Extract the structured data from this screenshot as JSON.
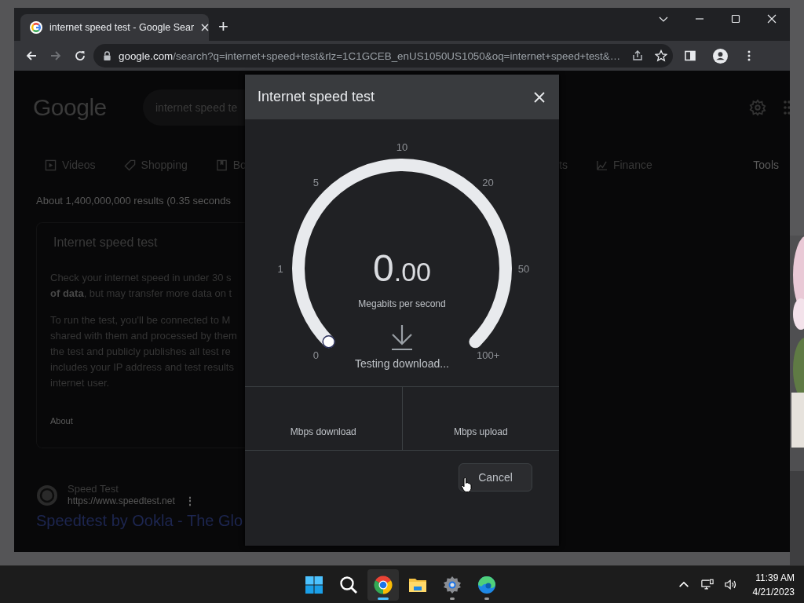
{
  "browser": {
    "tab": {
      "title": "internet speed test - Google Sear"
    },
    "new_tab": "+",
    "forward_disabled": true,
    "omnibox": {
      "host": "google.com",
      "path": "/search?q=internet+speed+test&rlz=1C1GCEB_enUS1050US1050&oq=internet+speed+test&…"
    }
  },
  "page": {
    "logo": "Google",
    "search": {
      "value": "internet speed te"
    },
    "nav_left": [
      {
        "label": "Videos",
        "kind": "video"
      },
      {
        "label": "Shopping",
        "kind": "tag"
      },
      {
        "label": "Bo",
        "kind": "book"
      }
    ],
    "nav_right": [
      {
        "label": "ts",
        "kind": "none"
      },
      {
        "label": "Finance",
        "kind": "chart"
      }
    ],
    "tools": "Tools",
    "stats": "About 1,400,000,000 results (0.35 seconds",
    "card": {
      "title": "Internet speed test",
      "paragraphs": [
        [
          "Check your internet speed in under 30 s",
          "**of data**, but may transfer more data on t"
        ],
        [
          "To run the test, you'll be connected to M",
          "shared with them and processed by them",
          "the test and publicly publishes all test re",
          "includes your IP address and test results",
          "internet user."
        ]
      ],
      "about": "About"
    },
    "result": {
      "site": "Speed Test",
      "url": "https://www.speedtest.net",
      "menu": "⋮",
      "link": "Speedtest by Ookla - The Glo"
    }
  },
  "dialog": {
    "title": "Internet speed test",
    "gauge": {
      "ticks": [
        "0",
        "1",
        "5",
        "10",
        "20",
        "50",
        "100+"
      ],
      "value_whole": "0",
      "value_fraction": ".00",
      "unit": "Megabits per second",
      "status": "Testing download..."
    },
    "results": [
      {
        "label": "Mbps download"
      },
      {
        "label": "Mbps upload"
      }
    ],
    "cancel": "Cancel"
  },
  "taskbar": {
    "apps": [
      {
        "kind": "start",
        "open": false,
        "selected": false
      },
      {
        "kind": "search",
        "open": false,
        "selected": false
      },
      {
        "kind": "chrome",
        "open": true,
        "selected": true
      },
      {
        "kind": "files",
        "open": false,
        "selected": false
      },
      {
        "kind": "settings",
        "open": true,
        "selected": false
      },
      {
        "kind": "edge",
        "open": true,
        "selected": false
      }
    ],
    "time": "11:39 AM",
    "date": "4/21/2023"
  }
}
